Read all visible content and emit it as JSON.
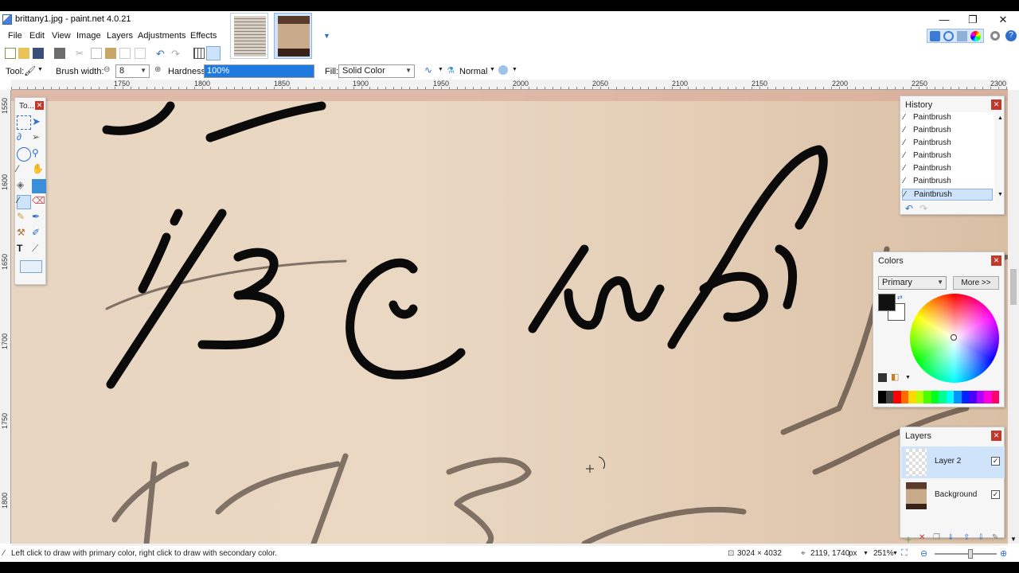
{
  "window": {
    "title": "brittany1.jpg - paint.net 4.0.21",
    "controls": {
      "minimize": "—",
      "maximize": "❐",
      "close": "✕"
    }
  },
  "menu": [
    "File",
    "Edit",
    "View",
    "Image",
    "Layers",
    "Adjustments",
    "Effects"
  ],
  "tool_options": {
    "tool_label": "Tool:",
    "brush_width_label": "Brush width:",
    "brush_width_value": "8",
    "hardness_label": "Hardness:",
    "hardness_value": "100%",
    "hardness_fraction": 1.0,
    "fill_label": "Fill:",
    "fill_value": "Solid Color",
    "blend_mode": "Normal"
  },
  "ruler": {
    "horizontal": [
      "1750",
      "1800",
      "1850",
      "1900",
      "1950",
      "2000",
      "2050",
      "2100",
      "2150",
      "2200",
      "2250",
      "2300"
    ],
    "vertical": [
      "1550",
      "1600",
      "1650",
      "1700",
      "1750",
      "1800"
    ]
  },
  "tools_panel": {
    "title": "To..."
  },
  "history": {
    "title": "History",
    "items": [
      "Paintbrush",
      "Paintbrush",
      "Paintbrush",
      "Paintbrush",
      "Paintbrush",
      "Paintbrush",
      "Paintbrush"
    ],
    "selected_index": 6
  },
  "colors": {
    "title": "Colors",
    "mode": "Primary",
    "more_button": "More >>",
    "primary": "#111111",
    "secondary": "#ffffff",
    "palette": [
      "#000000",
      "#404040",
      "#ff0000",
      "#ff6a00",
      "#ffd800",
      "#b6ff00",
      "#4cff00",
      "#00ff21",
      "#00ff90",
      "#00ffff",
      "#0094ff",
      "#0026ff",
      "#4800ff",
      "#b200ff",
      "#ff00dc",
      "#ff006e"
    ]
  },
  "layers": {
    "title": "Layers",
    "items": [
      {
        "name": "Layer 2",
        "visible": true
      },
      {
        "name": "Background",
        "visible": true
      }
    ]
  },
  "status": {
    "hint": "Left click to draw with primary color, right click to draw with secondary color.",
    "image_size": "3024 × 4032",
    "cursor_pos": "2119, 1740",
    "units": "px",
    "zoom": "251%"
  },
  "accent": "#1f7ae0"
}
